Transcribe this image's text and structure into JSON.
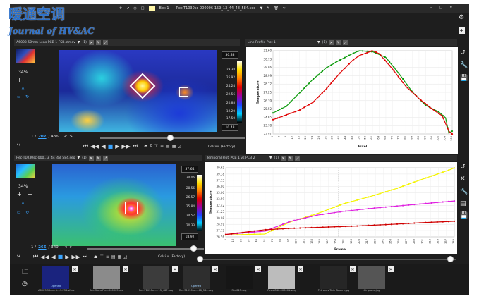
{
  "watermark": {
    "line1": "暖通空调",
    "line2": "Journal of HV&AC"
  },
  "window": {
    "controls": [
      "–",
      "▢",
      "✕"
    ]
  },
  "toolbar": {
    "box_label": "Box 1",
    "file_select": "Rec-T1030sc-000006-159_13_44_48_584.seq"
  },
  "top_video": {
    "title": "A6003 50mm Lens PCB 1-FSB.sfmov",
    "count": "(1)",
    "zoom": "34%",
    "frame_current": "207",
    "frame_total": "/ 436",
    "frame_prefix": "1 /",
    "scale_max": "30.88",
    "scale_min": "10.48",
    "scale_ticks": [
      "29.38",
      "25.92",
      "24.24",
      "22.56",
      "20.88",
      "19.20",
      "17.50"
    ],
    "units": "Celsius (Factory)",
    "frame_num": "0"
  },
  "bottom_video": {
    "title": "Rec-T1030sc-000...3_44_48_584.seq",
    "count": "(1)",
    "zoom": "34%",
    "frame_current": "266",
    "frame_total": "/ 349",
    "frame_prefix": "1 /",
    "scale_max": "37.64",
    "scale_min": "18.92",
    "scale_ticks": [
      "34.06",
      "28.56",
      "26.57",
      "25.84",
      "24.57",
      "20.33"
    ],
    "units": "Celsius (Factory)"
  },
  "line_profile": {
    "title": "Line Profile Plot 1",
    "count": "(1)"
  },
  "temporal_plot": {
    "title": "Temporal Plot_PCB 1 vs PCB 2",
    "count": "(1)"
  },
  "thumbnails": [
    {
      "label": "A6003 50mm L...1-FSB.sfmov",
      "tag": "Opened",
      "color": "#1a237e"
    },
    {
      "label": "Rec-StandFree-000005.seq",
      "tag": "",
      "color": "#8b8b8b"
    },
    {
      "label": "Rec-T1030sc-...13_487.seq",
      "tag": "",
      "color": "#3c3c3c"
    },
    {
      "label": "Rec-T1030sc-...48_584.seq",
      "tag": "Opened",
      "color": "#2e2e2e"
    },
    {
      "label": "Rec025.seq",
      "tag": "",
      "color": "#161616"
    },
    {
      "label": "Rec-A346-000001.seq",
      "tag": "",
      "color": "#bcbcbc"
    },
    {
      "label": "Petronas Twin Towers.jpg",
      "tag": "",
      "color": "#262626"
    },
    {
      "label": "Air plane.jpg",
      "tag": "",
      "color": "#555"
    }
  ],
  "chart_data": [
    {
      "type": "line",
      "title": "Line Profile Plot 1",
      "xlabel": "Pixel",
      "ylabel": "Temperature",
      "ylim": [
        22.91,
        31.6
      ],
      "y_ticks": [
        "31.60",
        "30.73",
        "29.86",
        "28.99",
        "28.12",
        "27.25",
        "26.39",
        "25.52",
        "24.65",
        "23.78",
        "22.91"
      ],
      "x_ticks": [
        "0",
        "4",
        "8",
        "12",
        "16",
        "20",
        "24",
        "28",
        "32",
        "36",
        "40",
        "44",
        "48",
        "52",
        "56",
        "60",
        "64",
        "68",
        "72",
        "76",
        "80",
        "84",
        "88",
        "92",
        "96",
        "100",
        "104",
        "108"
      ],
      "series": [
        {
          "color": "#0a9a0a",
          "points": [
            [
              0,
              25.1
            ],
            [
              8,
              25.8
            ],
            [
              16,
              27.2
            ],
            [
              24,
              28.6
            ],
            [
              32,
              29.8
            ],
            [
              40,
              30.6
            ],
            [
              48,
              31.3
            ],
            [
              52,
              31.6
            ],
            [
              60,
              31.5
            ],
            [
              68,
              30.9
            ],
            [
              76,
              29.2
            ],
            [
              84,
              27.3
            ],
            [
              92,
              25.9
            ],
            [
              100,
              25.2
            ],
            [
              104,
              24.6
            ],
            [
              106,
              23.0
            ],
            [
              108,
              23.2
            ]
          ]
        },
        {
          "color": "#e00000",
          "points": [
            [
              0,
              24.4
            ],
            [
              8,
              24.9
            ],
            [
              16,
              25.4
            ],
            [
              24,
              26.2
            ],
            [
              32,
              27.6
            ],
            [
              40,
              29.2
            ],
            [
              48,
              30.6
            ],
            [
              52,
              31.1
            ],
            [
              60,
              31.6
            ],
            [
              64,
              31.3
            ],
            [
              72,
              29.7
            ],
            [
              80,
              27.9
            ],
            [
              88,
              26.6
            ],
            [
              96,
              25.5
            ],
            [
              102,
              24.8
            ],
            [
              106,
              23.2
            ],
            [
              108,
              22.9
            ]
          ]
        }
      ]
    },
    {
      "type": "line",
      "title": "Temporal Plot_PCB 1 vs PCB 2",
      "xlabel": "Frame",
      "ylabel": "Temperature",
      "ylim": [
        26.0,
        40.63
      ],
      "y_ticks": [
        "40.63",
        "39.38",
        "37.13",
        "36.00",
        "35.00",
        "33.59",
        "32.42",
        "31.25",
        "30.08",
        "28.91",
        "27.73",
        "26.56"
      ],
      "x_ticks": [
        "1",
        "13",
        "25",
        "37",
        "49",
        "61",
        "73",
        "85",
        "97",
        "109",
        "121",
        "133",
        "145",
        "157",
        "169",
        "181",
        "193",
        "205",
        "217",
        "229",
        "241",
        "253",
        "265",
        "277",
        "289",
        "301",
        "313",
        "325",
        "337",
        "349"
      ],
      "series": [
        {
          "color": "#f4f400",
          "points": [
            [
              1,
              26.4
            ],
            [
              60,
              26.6
            ],
            [
              100,
              29.2
            ],
            [
              140,
              30.9
            ],
            [
              180,
              33.0
            ],
            [
              220,
              34.5
            ],
            [
              260,
              36.2
            ],
            [
              300,
              38.2
            ],
            [
              340,
              40.1
            ],
            [
              349,
              40.6
            ]
          ]
        },
        {
          "color": "#e020e0",
          "points": [
            [
              1,
              26.5
            ],
            [
              60,
              27.2
            ],
            [
              100,
              29.3
            ],
            [
              140,
              30.6
            ],
            [
              180,
              31.4
            ],
            [
              220,
              32.0
            ],
            [
              260,
              32.5
            ],
            [
              300,
              33.0
            ],
            [
              349,
              33.6
            ]
          ]
        },
        {
          "color": "#d00000",
          "points": [
            [
              1,
              26.5
            ],
            [
              60,
              27.5
            ],
            [
              100,
              27.8
            ],
            [
              140,
              28.0
            ],
            [
              200,
              28.3
            ],
            [
              260,
              28.7
            ],
            [
              300,
              29.0
            ],
            [
              349,
              29.3
            ]
          ]
        }
      ]
    }
  ]
}
